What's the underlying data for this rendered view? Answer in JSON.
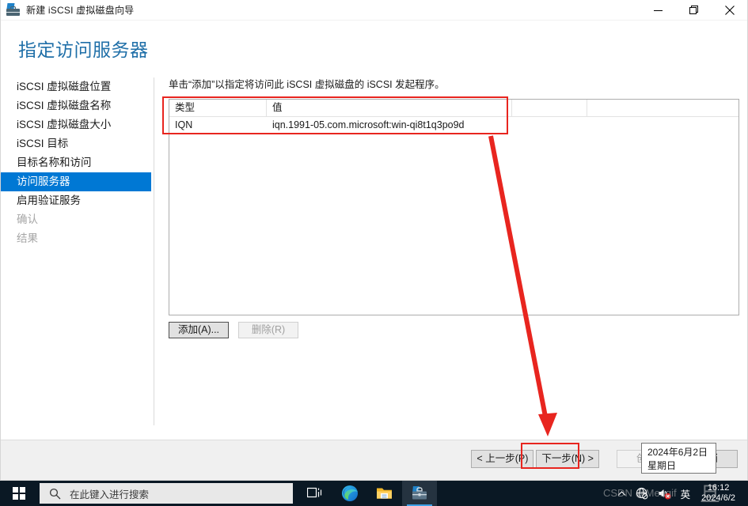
{
  "window": {
    "title": "新建 iSCSI 虚拟磁盘向导",
    "icon": "server-manager-icon",
    "minimize_label": "最小化",
    "restore_label": "还原",
    "close_label": "关闭"
  },
  "page": {
    "heading": "指定访问服务器",
    "instruction": "单击“添加”以指定将访问此 iSCSI 虚拟磁盘的 iSCSI 发起程序。"
  },
  "sidebar": {
    "items": [
      {
        "label": "iSCSI 虚拟磁盘位置",
        "state": "normal"
      },
      {
        "label": "iSCSI 虚拟磁盘名称",
        "state": "normal"
      },
      {
        "label": "iSCSI 虚拟磁盘大小",
        "state": "normal"
      },
      {
        "label": "iSCSI 目标",
        "state": "normal"
      },
      {
        "label": "目标名称和访问",
        "state": "normal"
      },
      {
        "label": "访问服务器",
        "state": "selected"
      },
      {
        "label": "启用验证服务",
        "state": "normal"
      },
      {
        "label": "确认",
        "state": "disabled"
      },
      {
        "label": "结果",
        "state": "disabled"
      }
    ]
  },
  "initiator_list": {
    "columns": [
      "类型",
      "值",
      "",
      ""
    ],
    "rows": [
      {
        "type": "IQN",
        "value": "iqn.1991-05.com.microsoft:win-qi8t1q3po9d"
      }
    ]
  },
  "list_buttons": {
    "add": "添加(A)...",
    "remove": "删除(R)"
  },
  "footer": {
    "previous": "< 上一步(P)",
    "next": "下一步(N) >",
    "create": "创建",
    "cancel": "取消"
  },
  "tooltip": {
    "date": "2024年6月2日",
    "weekday": "星期日"
  },
  "taskbar": {
    "start_label": "开始",
    "search_placeholder": "在此键入进行搜索",
    "taskview_label": "任务视图",
    "apps": [
      {
        "name": "edge-icon",
        "active": false
      },
      {
        "name": "file-explorer-icon",
        "active": false
      },
      {
        "name": "server-manager-icon",
        "active": true
      }
    ],
    "tray": {
      "overflow": "︿",
      "network": "network-offline-icon",
      "volume": "volume-muted-icon",
      "ime": "英",
      "time": "16:12",
      "date": "2024/6/2"
    }
  },
  "watermark": {
    "text": "CSDN @Meaqif"
  },
  "colors": {
    "accent": "#0078d4",
    "heading": "#1f6fa8",
    "annotation": "#e8251f",
    "taskbar": "#0a1824"
  }
}
